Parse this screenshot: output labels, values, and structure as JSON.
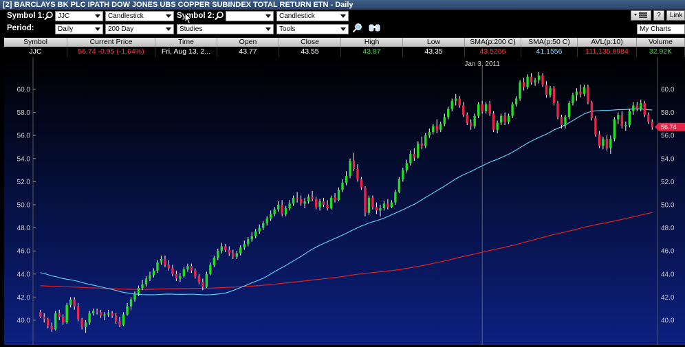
{
  "window": {
    "title": "[2] BARCLAYS BK PLC IPATH DOW JONES UBS COPPER SUBINDEX TOTAL RETURN ETN - Daily"
  },
  "toolbar": {
    "symbol1_label": "Symbol 1:",
    "symbol1_value": "JJC",
    "chart_type1": "Candlestick",
    "symbol2_label": "Symbol 2:",
    "symbol2_value": "",
    "chart_type2": "Candlestick",
    "period_label": "Period:",
    "period_value": "Daily",
    "range_value": "200 Day",
    "studies_value": "Studies",
    "tools_value": "Tools",
    "help_label": "?",
    "link_label": "Link",
    "my_charts_label": "My Charts"
  },
  "quote": {
    "headers": [
      "Symbol",
      "Current Price",
      "Time",
      "Open",
      "Close",
      "High",
      "Low",
      "SMA(p:200 C)",
      "SMA(p:50 C)",
      "AVL(p:10)",
      "Volume"
    ],
    "values": {
      "symbol": "JJC",
      "price": "56.74",
      "change": "-0.95 (-1.64%)",
      "time": "Fri, Aug 13, 2...",
      "open": "43.77",
      "close": "43.55",
      "high": "43.87",
      "low": "43.35",
      "sma200": "43.5266",
      "sma50": "41.1556",
      "avl": "111,135.8984",
      "volume": "32.92K"
    },
    "colors": {
      "price": "#ff3b3b",
      "high": "#33dd33",
      "sma200": "#ff3b3b",
      "sma50": "#7fd9ff",
      "volume": "#33dd33"
    }
  },
  "chart_data": {
    "type": "candlestick",
    "date_marker": "Jan 3, 2011",
    "y_ticks": [
      "60.0",
      "58.0",
      "56.0",
      "54.0",
      "52.0",
      "50.0",
      "48.0",
      "46.0",
      "44.0",
      "42.0",
      "40.0"
    ],
    "ylim": [
      39.5,
      61.5
    ],
    "last_price_label": "56.74",
    "colors": {
      "up": "#22dd22",
      "down": "#e8244a",
      "sma200": "#e02020",
      "sma50": "#5fc8ea",
      "bg_top": "#000000",
      "bg_bottom": "#0c2080"
    },
    "candles": [
      [
        40.7,
        40.9,
        40.2,
        40.3
      ],
      [
        40.3,
        40.6,
        39.8,
        40.1
      ],
      [
        40.1,
        40.2,
        39.3,
        39.5
      ],
      [
        39.5,
        39.8,
        39.0,
        39.2
      ],
      [
        39.2,
        40.8,
        39.1,
        40.6
      ],
      [
        40.6,
        40.9,
        40.0,
        40.3
      ],
      [
        40.3,
        40.5,
        39.6,
        39.8
      ],
      [
        39.8,
        41.5,
        39.7,
        41.3
      ],
      [
        41.3,
        42.0,
        41.1,
        41.8
      ],
      [
        41.8,
        42.0,
        40.9,
        41.2
      ],
      [
        41.2,
        41.5,
        39.9,
        40.1
      ],
      [
        40.1,
        40.2,
        39.2,
        39.4
      ],
      [
        39.4,
        40.0,
        38.9,
        39.8
      ],
      [
        39.8,
        40.8,
        39.6,
        40.6
      ],
      [
        40.6,
        41.0,
        40.4,
        40.8
      ],
      [
        40.8,
        41.0,
        40.5,
        40.7
      ],
      [
        40.7,
        40.9,
        40.2,
        40.4
      ],
      [
        40.4,
        40.7,
        40.0,
        40.5
      ],
      [
        40.5,
        40.9,
        40.3,
        40.6
      ],
      [
        40.6,
        40.8,
        40.2,
        40.4
      ],
      [
        40.4,
        40.6,
        39.7,
        39.9
      ],
      [
        39.9,
        40.3,
        39.4,
        39.6
      ],
      [
        39.6,
        40.7,
        39.5,
        40.5
      ],
      [
        40.5,
        41.5,
        40.4,
        41.2
      ],
      [
        41.2,
        42.0,
        40.9,
        41.8
      ],
      [
        41.8,
        42.5,
        41.6,
        42.3
      ],
      [
        42.3,
        43.0,
        42.1,
        42.8
      ],
      [
        42.8,
        43.5,
        42.6,
        43.1
      ],
      [
        43.1,
        43.8,
        42.9,
        43.6
      ],
      [
        43.6,
        44.2,
        43.4,
        43.9
      ],
      [
        43.9,
        44.5,
        43.7,
        44.3
      ],
      [
        44.3,
        45.2,
        44.1,
        45.0
      ],
      [
        45.0,
        45.6,
        44.8,
        45.3
      ],
      [
        45.3,
        45.6,
        44.6,
        44.8
      ],
      [
        44.8,
        45.2,
        44.3,
        44.5
      ],
      [
        44.5,
        44.8,
        43.8,
        44.0
      ],
      [
        44.0,
        44.3,
        43.4,
        43.6
      ],
      [
        43.6,
        44.1,
        43.3,
        43.8
      ],
      [
        43.8,
        44.6,
        43.7,
        44.4
      ],
      [
        44.4,
        44.9,
        44.2,
        44.7
      ],
      [
        44.7,
        44.9,
        44.1,
        44.3
      ],
      [
        44.3,
        44.5,
        43.6,
        43.8
      ],
      [
        43.8,
        44.0,
        43.1,
        43.3
      ],
      [
        43.3,
        43.6,
        42.6,
        42.9
      ],
      [
        42.9,
        44.2,
        42.8,
        44.0
      ],
      [
        44.0,
        45.0,
        43.9,
        44.8
      ],
      [
        44.8,
        45.6,
        44.6,
        45.4
      ],
      [
        45.4,
        46.2,
        45.2,
        46.0
      ],
      [
        46.0,
        46.7,
        45.8,
        46.4
      ],
      [
        46.4,
        46.6,
        45.9,
        46.1
      ],
      [
        46.1,
        46.4,
        45.6,
        45.8
      ],
      [
        45.8,
        46.1,
        45.3,
        45.5
      ],
      [
        45.5,
        46.0,
        45.3,
        45.8
      ],
      [
        45.8,
        46.5,
        45.6,
        46.3
      ],
      [
        46.3,
        46.9,
        46.1,
        46.6
      ],
      [
        46.6,
        47.2,
        46.4,
        47.0
      ],
      [
        47.0,
        47.6,
        46.8,
        47.3
      ],
      [
        47.3,
        47.9,
        47.1,
        47.7
      ],
      [
        47.7,
        48.3,
        47.5,
        48.0
      ],
      [
        48.0,
        48.6,
        47.8,
        48.4
      ],
      [
        48.4,
        49.0,
        48.2,
        48.8
      ],
      [
        48.8,
        49.5,
        48.6,
        49.2
      ],
      [
        49.2,
        49.8,
        49.0,
        49.6
      ],
      [
        49.6,
        50.3,
        49.4,
        50.0
      ],
      [
        50.0,
        50.4,
        49.0,
        49.2
      ],
      [
        49.2,
        49.9,
        49.0,
        49.7
      ],
      [
        49.7,
        50.4,
        49.5,
        50.1
      ],
      [
        50.1,
        50.8,
        49.9,
        50.6
      ],
      [
        50.6,
        51.1,
        50.2,
        50.5
      ],
      [
        50.5,
        50.8,
        49.9,
        50.1
      ],
      [
        50.1,
        50.6,
        49.7,
        50.3
      ],
      [
        50.3,
        50.9,
        50.1,
        50.7
      ],
      [
        50.7,
        51.2,
        50.3,
        50.5
      ],
      [
        50.5,
        50.7,
        49.6,
        49.8
      ],
      [
        49.8,
        50.5,
        49.5,
        50.3
      ],
      [
        50.3,
        50.6,
        49.8,
        50.0
      ],
      [
        50.0,
        50.4,
        49.5,
        49.7
      ],
      [
        49.7,
        50.8,
        49.6,
        50.6
      ],
      [
        50.6,
        51.0,
        50.2,
        50.4
      ],
      [
        50.4,
        51.5,
        50.3,
        51.3
      ],
      [
        51.3,
        52.2,
        51.1,
        51.9
      ],
      [
        51.9,
        52.9,
        51.7,
        52.5
      ],
      [
        52.5,
        54.0,
        52.3,
        53.8
      ],
      [
        53.8,
        54.5,
        52.9,
        53.1
      ],
      [
        53.1,
        53.5,
        52.0,
        52.2
      ],
      [
        52.2,
        52.4,
        51.3,
        51.5
      ],
      [
        51.5,
        51.6,
        49.0,
        49.3
      ],
      [
        49.3,
        50.8,
        49.1,
        50.6
      ],
      [
        50.6,
        50.8,
        49.6,
        49.8
      ],
      [
        49.8,
        50.2,
        49.2,
        49.5
      ],
      [
        49.5,
        50.0,
        49.0,
        49.7
      ],
      [
        49.7,
        50.3,
        49.5,
        50.1
      ],
      [
        50.1,
        50.5,
        49.6,
        49.8
      ],
      [
        49.8,
        50.4,
        49.7,
        50.2
      ],
      [
        50.2,
        51.3,
        50.0,
        51.1
      ],
      [
        51.1,
        52.4,
        51.0,
        52.2
      ],
      [
        52.2,
        53.2,
        52.0,
        53.0
      ],
      [
        53.0,
        53.9,
        52.8,
        53.6
      ],
      [
        53.6,
        54.7,
        53.4,
        54.4
      ],
      [
        54.4,
        54.9,
        53.8,
        54.1
      ],
      [
        54.1,
        55.5,
        54.0,
        55.3
      ],
      [
        55.3,
        55.9,
        54.8,
        55.1
      ],
      [
        55.1,
        56.2,
        54.9,
        56.0
      ],
      [
        56.0,
        56.6,
        55.8,
        56.3
      ],
      [
        56.3,
        57.0,
        56.1,
        56.8
      ],
      [
        56.8,
        57.4,
        56.2,
        56.5
      ],
      [
        56.5,
        57.2,
        56.3,
        57.0
      ],
      [
        57.0,
        57.9,
        56.8,
        57.6
      ],
      [
        57.6,
        58.5,
        57.4,
        58.3
      ],
      [
        58.3,
        59.2,
        58.1,
        59.0
      ],
      [
        59.0,
        59.6,
        58.6,
        59.2
      ],
      [
        59.2,
        59.4,
        58.4,
        58.6
      ],
      [
        58.6,
        58.9,
        57.6,
        57.8
      ],
      [
        57.8,
        58.0,
        56.9,
        57.1
      ],
      [
        57.1,
        57.4,
        56.5,
        56.8
      ],
      [
        56.8,
        57.9,
        56.6,
        57.7
      ],
      [
        57.7,
        58.9,
        57.5,
        58.7
      ],
      [
        58.7,
        59.0,
        57.9,
        58.1
      ],
      [
        58.1,
        58.9,
        57.9,
        58.7
      ],
      [
        58.7,
        59.0,
        57.7,
        57.9
      ],
      [
        57.9,
        58.1,
        56.3,
        56.5
      ],
      [
        56.5,
        57.3,
        56.2,
        57.1
      ],
      [
        57.1,
        57.9,
        56.9,
        57.7
      ],
      [
        57.7,
        58.0,
        56.9,
        57.2
      ],
      [
        57.2,
        57.9,
        57.0,
        57.7
      ],
      [
        57.7,
        58.9,
        57.5,
        58.7
      ],
      [
        58.7,
        59.4,
        58.5,
        59.2
      ],
      [
        59.2,
        60.8,
        59.0,
        60.6
      ],
      [
        60.6,
        61.0,
        59.9,
        60.2
      ],
      [
        60.2,
        61.3,
        60.0,
        61.1
      ],
      [
        61.1,
        61.4,
        60.4,
        60.6
      ],
      [
        60.6,
        61.0,
        60.3,
        60.8
      ],
      [
        60.8,
        61.5,
        60.5,
        61.2
      ],
      [
        61.2,
        61.4,
        60.2,
        60.4
      ],
      [
        60.4,
        60.7,
        59.3,
        59.5
      ],
      [
        59.5,
        60.3,
        59.3,
        60.1
      ],
      [
        60.1,
        60.3,
        58.6,
        58.8
      ],
      [
        58.8,
        59.0,
        57.4,
        57.6
      ],
      [
        57.6,
        57.8,
        56.6,
        56.9
      ],
      [
        56.9,
        57.8,
        56.6,
        57.6
      ],
      [
        57.6,
        59.0,
        57.4,
        58.8
      ],
      [
        58.8,
        59.7,
        58.6,
        59.5
      ],
      [
        59.5,
        60.1,
        59.0,
        59.8
      ],
      [
        59.8,
        60.4,
        59.3,
        59.6
      ],
      [
        59.6,
        60.4,
        59.4,
        60.2
      ],
      [
        60.2,
        60.4,
        58.7,
        58.9
      ],
      [
        58.9,
        59.0,
        57.3,
        57.5
      ],
      [
        57.5,
        57.7,
        55.9,
        56.1
      ],
      [
        56.1,
        56.4,
        54.9,
        55.1
      ],
      [
        55.1,
        55.9,
        54.8,
        55.7
      ],
      [
        55.7,
        56.0,
        54.7,
        54.9
      ],
      [
        54.9,
        56.0,
        54.4,
        55.7
      ],
      [
        55.7,
        57.6,
        55.5,
        57.4
      ],
      [
        57.4,
        58.0,
        57.0,
        57.8
      ],
      [
        57.8,
        58.1,
        56.6,
        56.8
      ],
      [
        56.8,
        57.2,
        56.4,
        56.9
      ],
      [
        56.9,
        58.3,
        56.7,
        58.1
      ],
      [
        58.1,
        58.9,
        57.8,
        58.6
      ],
      [
        58.6,
        58.9,
        58.1,
        58.3
      ],
      [
        58.3,
        59.1,
        58.1,
        58.8
      ],
      [
        58.8,
        59.0,
        57.6,
        57.8
      ],
      [
        57.8,
        58.0,
        57.0,
        57.2
      ],
      [
        57.2,
        57.4,
        56.5,
        56.74
      ]
    ]
  }
}
